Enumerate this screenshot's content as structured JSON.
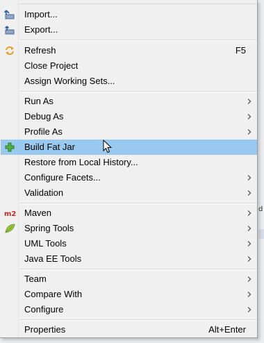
{
  "menu": {
    "items": [
      {
        "label": "Import...",
        "icon": "import-icon",
        "shortcut": "",
        "submenu": false
      },
      {
        "label": "Export...",
        "icon": "export-icon",
        "shortcut": "",
        "submenu": false
      },
      {
        "label": "Refresh",
        "icon": "refresh-icon",
        "shortcut": "F5",
        "submenu": false
      },
      {
        "label": "Close Project",
        "icon": "",
        "shortcut": "",
        "submenu": false
      },
      {
        "label": "Assign Working Sets...",
        "icon": "",
        "shortcut": "",
        "submenu": false
      },
      {
        "label": "Run As",
        "icon": "",
        "shortcut": "",
        "submenu": true
      },
      {
        "label": "Debug As",
        "icon": "",
        "shortcut": "",
        "submenu": true
      },
      {
        "label": "Profile As",
        "icon": "",
        "shortcut": "",
        "submenu": true
      },
      {
        "label": "Build Fat Jar",
        "icon": "plus-icon",
        "shortcut": "",
        "submenu": false,
        "highlighted": true
      },
      {
        "label": "Restore from Local History...",
        "icon": "",
        "shortcut": "",
        "submenu": false
      },
      {
        "label": "Configure Facets...",
        "icon": "",
        "shortcut": "",
        "submenu": true
      },
      {
        "label": "Validation",
        "icon": "",
        "shortcut": "",
        "submenu": true
      },
      {
        "label": "Maven",
        "icon": "maven-m2-icon",
        "shortcut": "",
        "submenu": true
      },
      {
        "label": "Spring Tools",
        "icon": "spring-leaf-icon",
        "shortcut": "",
        "submenu": true
      },
      {
        "label": "UML Tools",
        "icon": "",
        "shortcut": "",
        "submenu": true
      },
      {
        "label": "Java EE Tools",
        "icon": "",
        "shortcut": "",
        "submenu": true
      },
      {
        "label": "Team",
        "icon": "",
        "shortcut": "",
        "submenu": true
      },
      {
        "label": "Compare With",
        "icon": "",
        "shortcut": "",
        "submenu": true
      },
      {
        "label": "Configure",
        "icon": "",
        "shortcut": "",
        "submenu": true
      },
      {
        "label": "Properties",
        "icon": "",
        "shortcut": "Alt+Enter",
        "submenu": false
      }
    ],
    "maven_icon_text": "m2"
  },
  "colors": {
    "highlight": "#99c9ef",
    "menu_background": "#f0f0f0"
  },
  "background_fragment": "d"
}
